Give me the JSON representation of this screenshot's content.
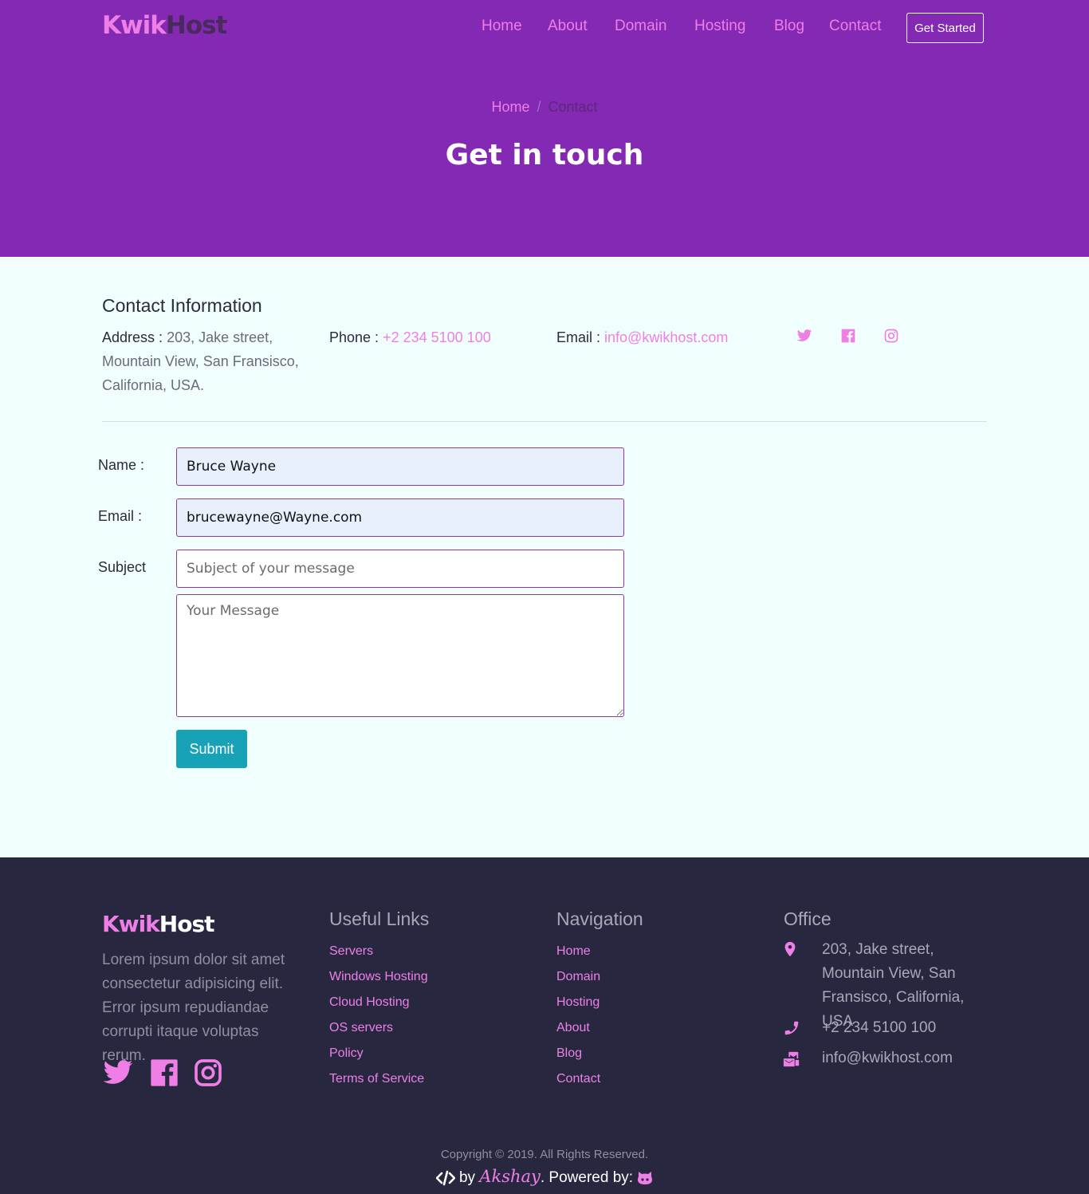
{
  "brand": {
    "part1": "Kwik",
    "part2": "Host"
  },
  "nav": {
    "items": [
      "Home",
      "About",
      "Domain",
      "Hosting",
      "Blog",
      "Contact"
    ],
    "cta": "Get Started"
  },
  "breadcrumb": {
    "home": "Home",
    "separator": "/",
    "current": "Contact"
  },
  "hero": {
    "title": "Get in touch"
  },
  "contact_info": {
    "title": "Contact Information",
    "address_label": "Address :",
    "address_value": "203, Jake street, Mountain View, San Fransisco, California, USA.",
    "phone_label": "Phone :",
    "phone_value": "+2 234 5100 100",
    "email_label": "Email :",
    "email_value": "info@kwikhost.com",
    "social_icons": [
      "twitter-icon",
      "facebook-icon",
      "instagram-icon"
    ]
  },
  "form": {
    "name_label": "Name :",
    "name_value": "Bruce Wayne",
    "email_label": "Email :",
    "email_value": "brucewayne@Wayne.com",
    "subject_label": "Subject",
    "subject_placeholder": "Subject of your message",
    "message_placeholder": "Your Message",
    "submit_label": "Submit"
  },
  "footer": {
    "brand": {
      "part1": "Kwik",
      "part2": "Host"
    },
    "description": "Lorem ipsum dolor sit amet consectetur adipisicing elit. Error ipsum repudiandae corrupti itaque voluptas rerum.",
    "useful_links": {
      "title": "Useful Links",
      "items": [
        "Servers",
        "Windows Hosting",
        "Cloud Hosting",
        "OS servers",
        "Policy",
        "Terms of Service"
      ]
    },
    "navigation": {
      "title": "Navigation",
      "items": [
        "Home",
        "Domain",
        "Hosting",
        "About",
        "Blog",
        "Contact"
      ]
    },
    "office": {
      "title": "Office",
      "address": "203, Jake street, Mountain View, San Fransisco, California, USA",
      "phone": "+2 234 5100 100",
      "email": "info@kwikhost.com"
    },
    "copyright": "Copyright © 2019. All Rights Reserved.",
    "credits": {
      "by": "by",
      "author": "Akshay",
      "powered": ". Powered by:"
    }
  },
  "colors": {
    "hero_bg": "#8329b3",
    "accent": "#ef7fe6",
    "footer_bg": "#272840",
    "submit_bg": "#17a2b8",
    "page_bg": "#f0fffe"
  }
}
